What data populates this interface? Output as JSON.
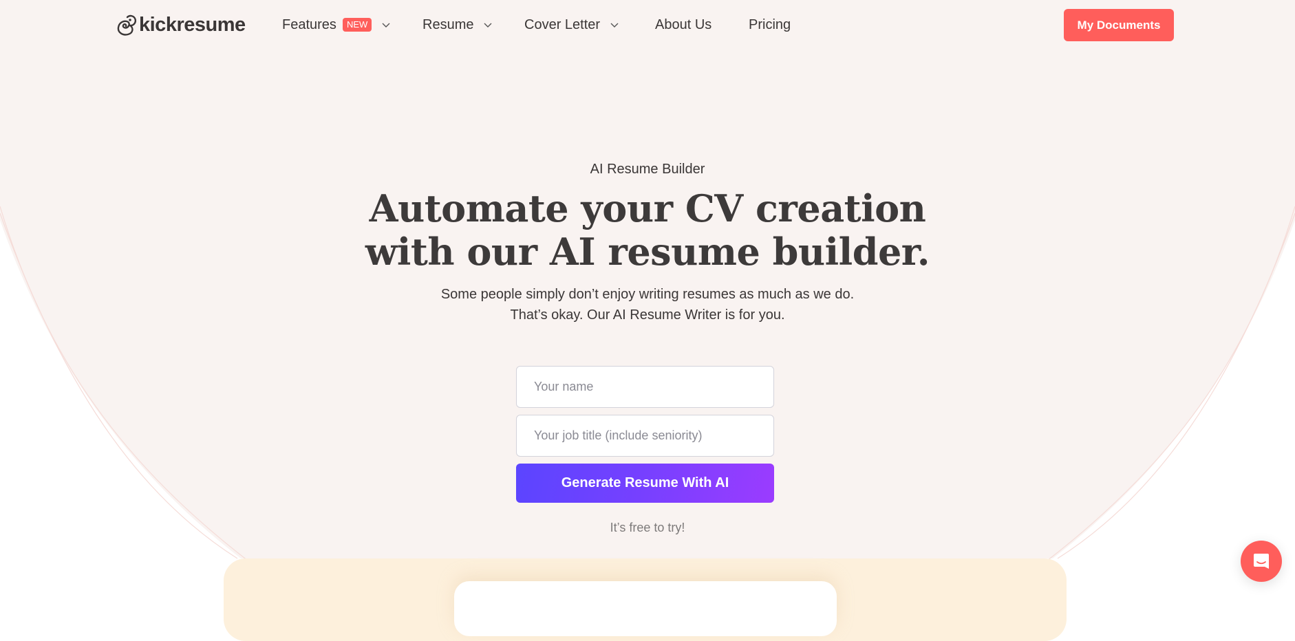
{
  "brand": {
    "name": "kickresume",
    "logo_icon": "chameleon-logo-icon"
  },
  "nav": {
    "items": [
      {
        "label": "Features",
        "badge": "NEW",
        "has_dropdown": true
      },
      {
        "label": "Resume",
        "has_dropdown": true
      },
      {
        "label": "Cover Letter",
        "has_dropdown": true
      },
      {
        "label": "About Us",
        "has_dropdown": false
      },
      {
        "label": "Pricing",
        "has_dropdown": false
      }
    ],
    "cta_label": "My Documents"
  },
  "hero": {
    "eyebrow": "AI Resume Builder",
    "headline_line1": "Automate your CV creation",
    "headline_line2": "with our AI resume builder.",
    "sub_line1": "Some people simply don’t enjoy writing resumes as much as we do.",
    "sub_line2": "That’s okay. Our AI Resume Writer is for you.",
    "name_placeholder": "Your name",
    "name_value": "",
    "job_placeholder": "Your job title (include seniority)",
    "job_value": "",
    "generate_label": "Generate Resume With AI",
    "free_note": "It’s free to try!"
  },
  "chat_widget": {
    "icon": "chat-bubble-icon"
  },
  "colors": {
    "accent": "#ff5e5b",
    "hero_bg": "#f9f3f1",
    "gradient_start": "#5b45ff",
    "gradient_end": "#9b3cff",
    "card_yellow": "#fdf0dc",
    "text": "#3d3a3a"
  }
}
